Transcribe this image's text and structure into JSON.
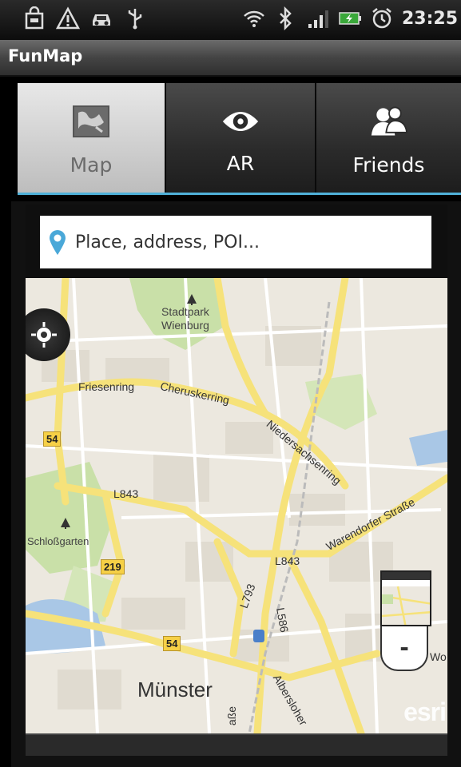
{
  "status_bar": {
    "time": "23:25",
    "left_icons": [
      "shopping-bag-icon",
      "warning-icon",
      "car-icon",
      "usb-icon"
    ],
    "right_icons": [
      "wifi-icon",
      "bluetooth-off-icon",
      "signal-icon",
      "battery-charging-icon",
      "alarm-icon"
    ]
  },
  "app": {
    "title": "FunMap"
  },
  "tabs": [
    {
      "label": "Map",
      "icon": "map-icon",
      "selected": true
    },
    {
      "label": "AR",
      "icon": "eye-icon",
      "selected": false
    },
    {
      "label": "Friends",
      "icon": "friends-icon",
      "selected": false
    }
  ],
  "search": {
    "placeholder": "Place, address, POI..."
  },
  "map": {
    "labels": {
      "park": "Stadtpark\nWienburg",
      "schloss": "Schloßgarten",
      "city": "Münster"
    },
    "roads": {
      "friesenring": "Friesenring",
      "cheruskerring": "Cheruskerring",
      "niedersachsenring": "Niedersachsenring",
      "warendorfer": "Warendorfer Straße",
      "l843_a": "L843",
      "l843_b": "L843",
      "l793": "L793",
      "l586": "L586",
      "albersloher": "Albersloher",
      "wo": "Wo",
      "gasse": "aße"
    },
    "shields": {
      "s54a": "54",
      "s219": "219",
      "s54b": "54"
    },
    "attribution": "esri",
    "zoom_out": "-"
  },
  "colors": {
    "accent": "#4fb0d8",
    "pin": "#4aa8d8",
    "road_yellow": "#f6e27a",
    "park_green": "#c7dfa6",
    "water": "#a7c6e8"
  }
}
